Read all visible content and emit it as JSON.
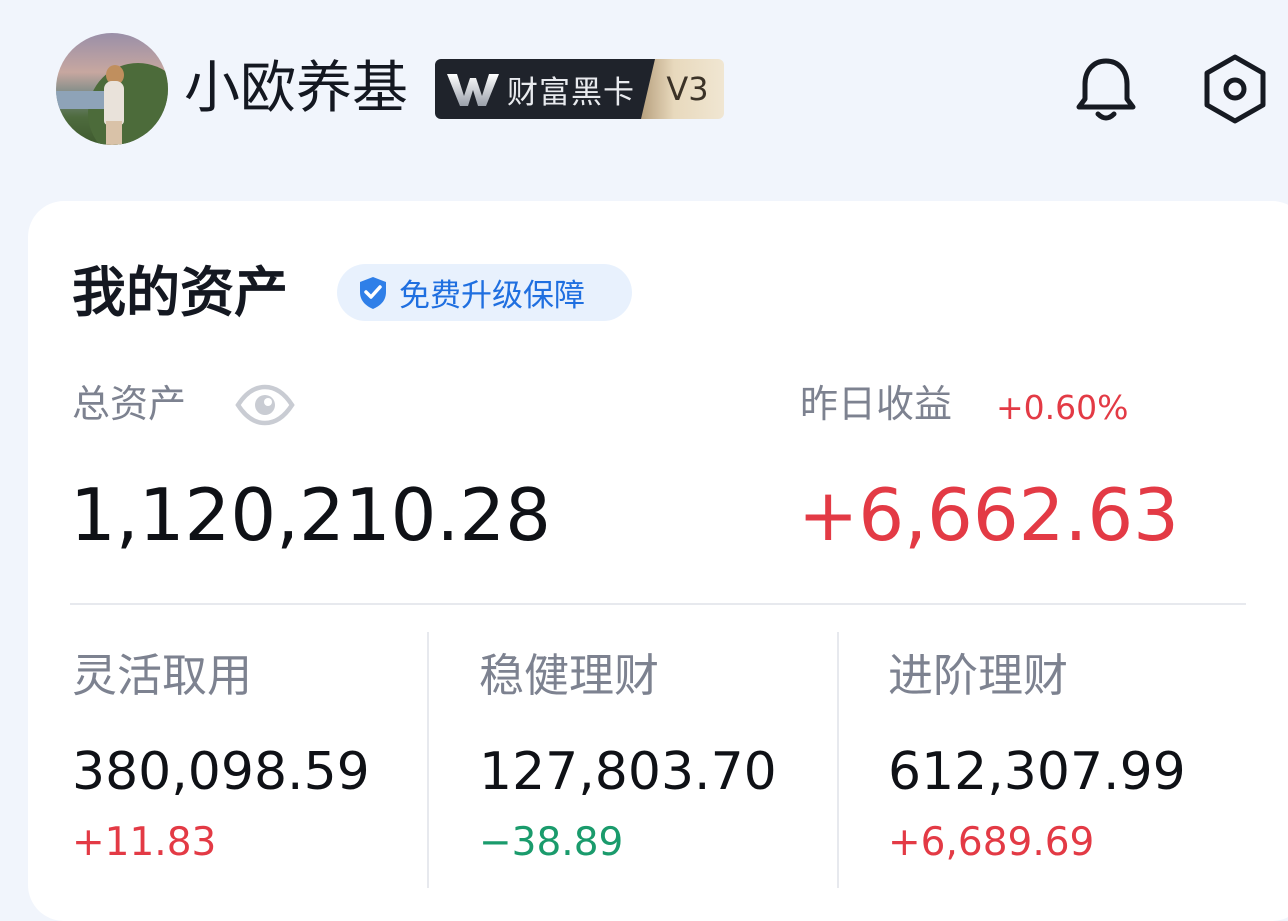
{
  "header": {
    "username": "小欧养基",
    "vip_badge": {
      "text": "财富黑卡",
      "level": "V3"
    },
    "icons": {
      "notification": "bell-icon",
      "settings": "settings-hex-icon"
    }
  },
  "assets": {
    "title": "我的资产",
    "upgrade_label": "免费升级保障",
    "total_label": "总资产",
    "total_value": "1,120,210.28",
    "yesterday_label": "昨日收益",
    "yesterday_pct": "+0.60%",
    "yesterday_value": "+6,662.63",
    "categories": [
      {
        "label": "灵活取用",
        "value": "380,098.59",
        "change": "+11.83"
      },
      {
        "label": "稳健理财",
        "value": "127,803.70",
        "change": "−38.89"
      },
      {
        "label": "进阶理财",
        "value": "612,307.99",
        "change": "+6,689.69"
      }
    ]
  },
  "colors": {
    "gain": "#e33a45",
    "loss": "#1a9b6c",
    "accent": "#1f6fe0",
    "background": "#f1f5fc"
  }
}
